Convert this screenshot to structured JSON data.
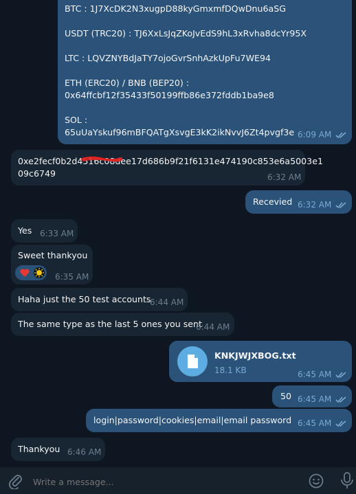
{
  "messages": {
    "crypto": {
      "btc": "BTC : 1J7XcDK2N3xugpD88kyGmxmfDQwDnu6aSG",
      "usdt": "USDT (TRC20) : TJ6XxLsJqZKoJvEdS9hL3xRvha8dcYr95X",
      "ltc": "LTC : LQVZNYBdJaTY7ojoGvrSnhAzkUpFu7WE94",
      "eth_label": "ETH (ERC20) / BNB (BEP20) :",
      "eth_addr": "0x64ffcbf12f35433f50199ffb86e372fddb1ba9e8",
      "sol_label": "SOL :",
      "sol_addr": "65uUaYskuf96mBFQATgXsvgE3kK2ikNvvJ6Zt4pvgf3e",
      "time": "6:09 AM"
    },
    "hash": {
      "line1": "0xe2fecf0b2d4516c08dee17d686b9f21f6131e474190c853e6a5003e1",
      "line2": "09c6749",
      "time": "6:32 AM"
    },
    "received": {
      "text": "Recevied",
      "time": "6:32 AM"
    },
    "yes": {
      "text": "Yes",
      "time": "6:33 AM"
    },
    "thanks": {
      "text": "Sweet thankyou",
      "time": "6:35 AM"
    },
    "haha": {
      "text": "Haha just the 50 test accounts",
      "time": "6:44 AM"
    },
    "same": {
      "text": "The same type as the last 5 ones you sent",
      "time": "6:44 AM"
    },
    "file": {
      "name": "KNKJWJXBOG.txt",
      "size": "18.1 KB",
      "time": "6:45 AM"
    },
    "fifty": {
      "text": "50",
      "time": "6:45 AM"
    },
    "format": {
      "text": "login|password|cookies|email|email password",
      "time": "6:45 AM"
    },
    "thankyou": {
      "text": "Thankyou",
      "time": "6:46 AM"
    }
  },
  "composer": {
    "placeholder": "Write a message..."
  },
  "icons": [
    "attach-icon",
    "emoji-icon",
    "mic-icon",
    "read-ticks-icon",
    "file-icon",
    "heart-icon",
    "sun-icon"
  ],
  "colors": {
    "background": "#0e1621",
    "incoming": "#182533",
    "outgoing": "#2b5278",
    "accent": "#5dade2"
  }
}
